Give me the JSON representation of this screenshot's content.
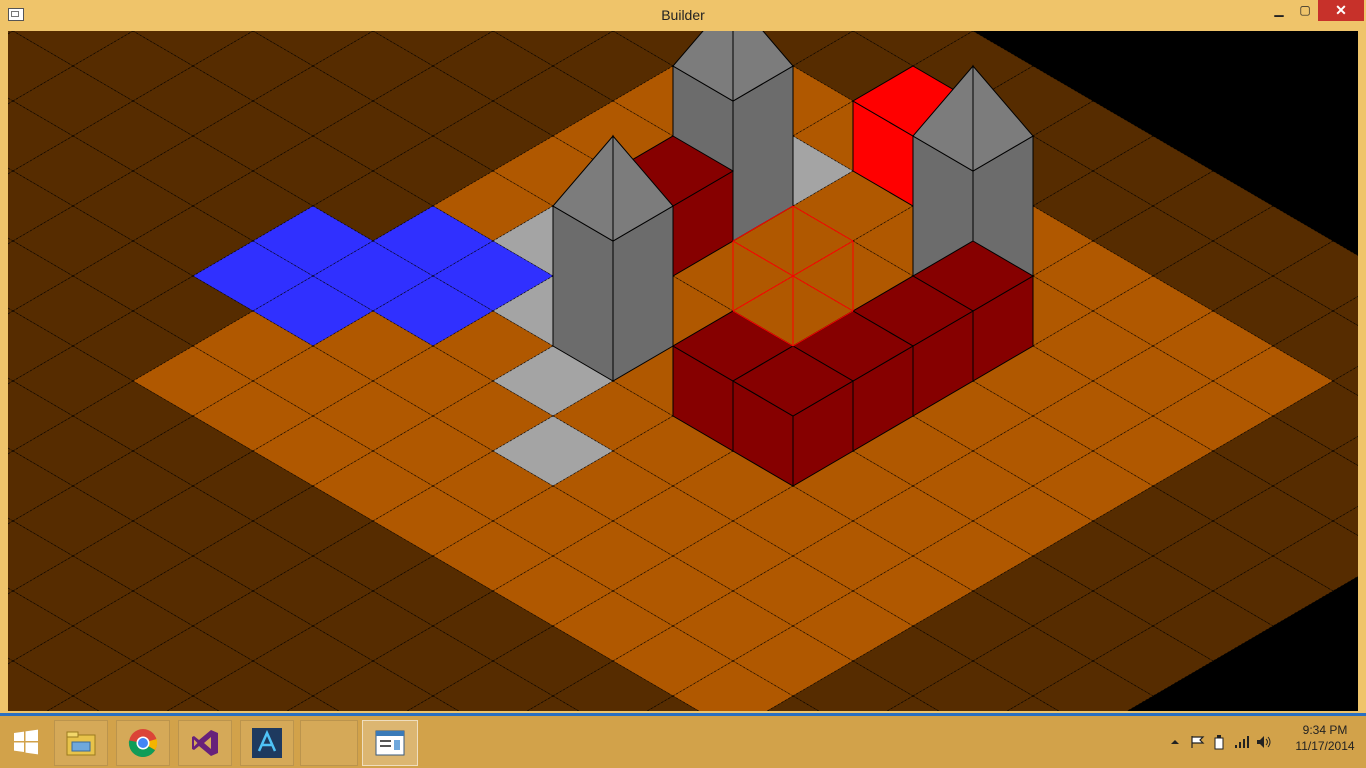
{
  "window": {
    "title": "Builder",
    "controls": {
      "minimize": "▁",
      "maximize": "▢",
      "close": "✕"
    }
  },
  "scene": {
    "description_grid": "isometric tile board",
    "colors": {
      "dark_ground": "#562c00",
      "ground": "#b05800",
      "stone": "#a4a4a4",
      "water": "#3030ff",
      "wall_top": "#860000",
      "wall_left": "#860000",
      "wall_right": "#860000",
      "wall_selected": "#ff0000",
      "tower_side": "#6c6c6c",
      "tower_roof": "#7c7c7c",
      "cursor": "#ff0000"
    }
  },
  "taskbar": {
    "apps": [
      {
        "name": "File Explorer",
        "icon": "folder-icon"
      },
      {
        "name": "Google Chrome",
        "icon": "chrome-icon"
      },
      {
        "name": "Visual Studio",
        "icon": "visual-studio-icon"
      },
      {
        "name": "Blend",
        "icon": "blend-icon"
      },
      {
        "name": "",
        "icon": ""
      },
      {
        "name": "Builder",
        "icon": "builder-window-icon"
      }
    ],
    "tray_icons": [
      "chevron-up-icon",
      "flag-icon",
      "power-plug-icon",
      "signal-icon",
      "speaker-icon"
    ],
    "time": "9:34 PM",
    "date": "11/17/2014"
  }
}
